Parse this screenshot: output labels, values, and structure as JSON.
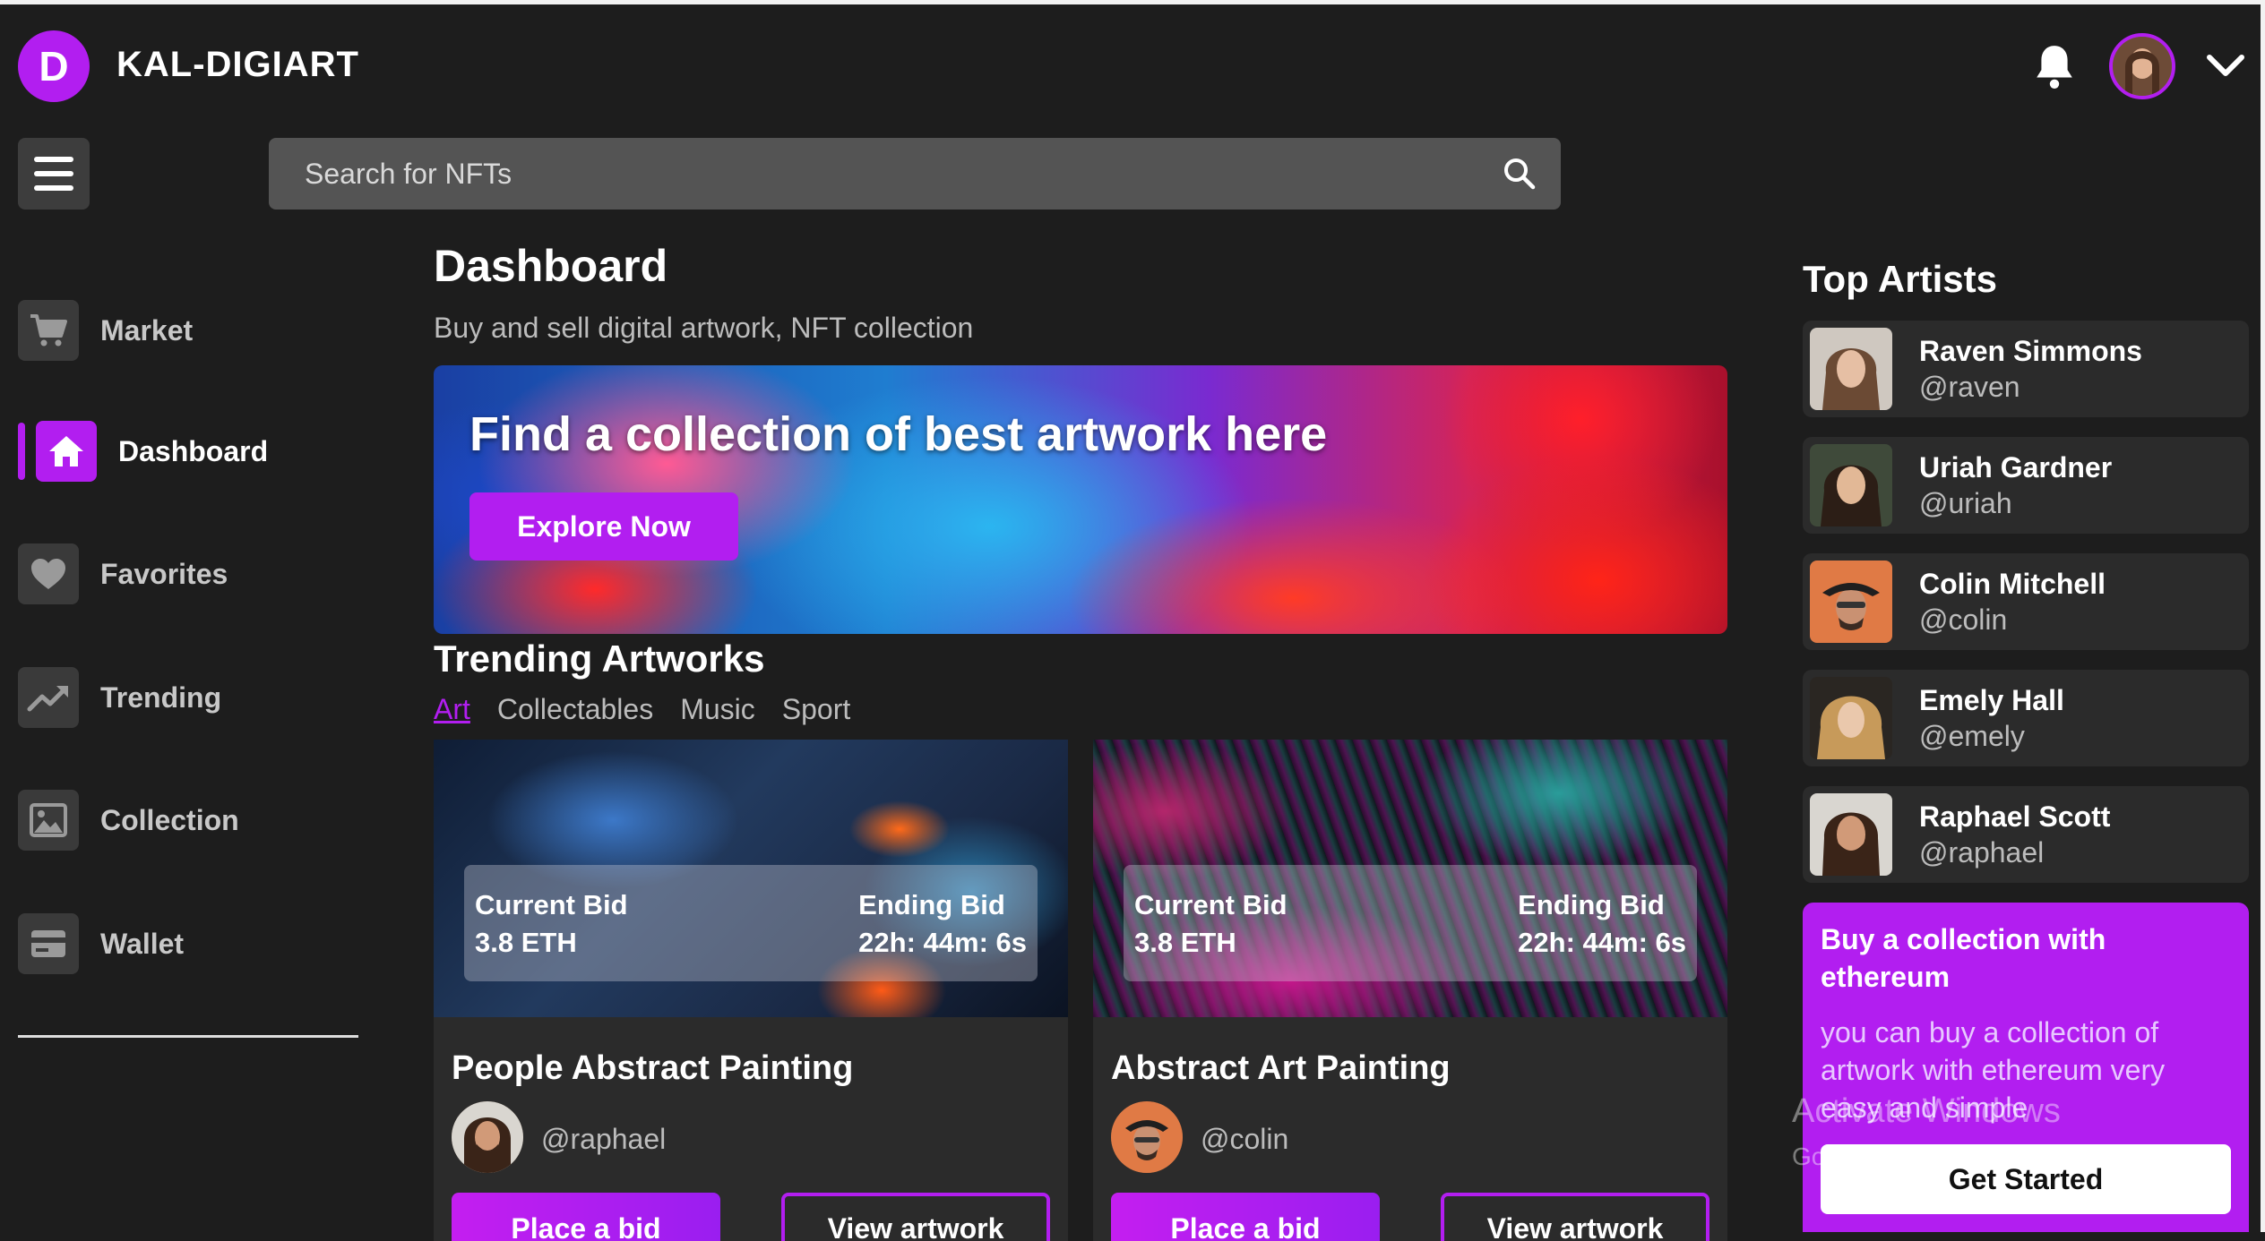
{
  "app": {
    "logo_letter": "D",
    "brand": "KAL-DIGIART"
  },
  "search": {
    "placeholder": "Search for NFTs"
  },
  "sidebar": {
    "items": [
      {
        "label": "Market",
        "icon": "cart-icon"
      },
      {
        "label": "Dashboard",
        "icon": "home-icon",
        "active": true
      },
      {
        "label": "Favorites",
        "icon": "heart-icon"
      },
      {
        "label": "Trending",
        "icon": "trend-icon"
      },
      {
        "label": "Collection",
        "icon": "image-icon"
      },
      {
        "label": "Wallet",
        "icon": "wallet-icon"
      }
    ]
  },
  "main": {
    "title": "Dashboard",
    "subtitle": "Buy and sell digital artwork, NFT collection",
    "banner": {
      "heading": "Find a collection of best artwork here",
      "button": "Explore Now"
    },
    "trending": {
      "title": "Trending Artworks",
      "tabs": [
        "Art",
        "Collectables",
        "Music",
        "Sport"
      ],
      "active_tab": "Art",
      "cards": [
        {
          "name": "People Abstract Painting",
          "handle": "@raphael",
          "current_bid_label": "Current Bid",
          "current_bid": "3.8 ETH",
          "ending_bid_label": "Ending Bid",
          "ending_bid": "22h: 44m: 6s",
          "bid_button": "Place a bid",
          "view_button": "View artwork"
        },
        {
          "name": "Abstract Art Painting",
          "handle": "@colin",
          "current_bid_label": "Current Bid",
          "current_bid": "3.8 ETH",
          "ending_bid_label": "Ending Bid",
          "ending_bid": "22h: 44m: 6s",
          "bid_button": "Place a bid",
          "view_button": "View artwork"
        }
      ]
    }
  },
  "top_artists": {
    "title": "Top Artists",
    "artists": [
      {
        "name": "Raven Simmons",
        "handle": "@raven"
      },
      {
        "name": "Uriah Gardner",
        "handle": "@uriah"
      },
      {
        "name": "Colin Mitchell",
        "handle": "@colin"
      },
      {
        "name": "Emely Hall",
        "handle": "@emely"
      },
      {
        "name": "Raphael Scott",
        "handle": "@raphael"
      }
    ]
  },
  "promo": {
    "title": "Buy a collection with ethereum",
    "text": "you can buy a collection of artwork with ethereum very easy and simple",
    "button": "Get Started"
  },
  "watermark": {
    "line1": "Activate Windows",
    "line2": "Go to Settings to activate Windows."
  },
  "colors": {
    "accent": "#b21ef0",
    "background": "#1d1d1d",
    "card": "#2b2b2b"
  }
}
